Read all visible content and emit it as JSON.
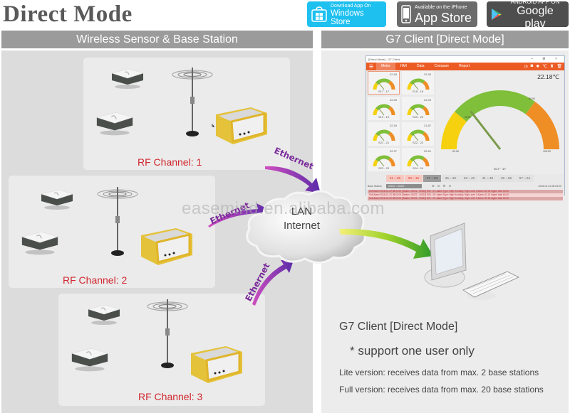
{
  "title": "Direct Mode",
  "store_badges": [
    {
      "small": "Download App On",
      "large": "Windows Store",
      "icon": "windows-icon",
      "color": "#1ec0f0"
    },
    {
      "small": "Available on the iPhone",
      "large": "App Store",
      "icon": "iphone-icon",
      "color": "#6b6b6b"
    },
    {
      "small": "ANDROID APP ON",
      "large": "Google play",
      "icon": "google-play-icon",
      "color": "#4e4e4e"
    }
  ],
  "sections": {
    "left_header": "Wireless Sensor & Base Station",
    "right_header": "G7 Client [Direct Mode]"
  },
  "rf_channels": [
    {
      "label": "RF Channel: 1"
    },
    {
      "label": "RF Channel: 2"
    },
    {
      "label": "RF Channel: 3"
    }
  ],
  "links": {
    "ethernet_label": "Ethernet",
    "cloud_line1": "LAN",
    "cloud_line2": "Internet",
    "watermark": "easemind.en.alibaba.com"
  },
  "app": {
    "window_title": "[Direct Mode] - G7 Client",
    "window_controls": "– ⚙ ×",
    "menu": [
      {
        "label": "Meter",
        "active": true
      },
      {
        "label": "HMI",
        "active": false
      },
      {
        "label": "Data",
        "active": false
      },
      {
        "label": "Compare",
        "active": false
      },
      {
        "label": "Report",
        "active": false
      }
    ],
    "menu_icons": [
      "clock-icon",
      "camera-icon",
      "sun-icon",
      "celsius-icon",
      "alarm-icon",
      "trash-icon"
    ],
    "menu_icon_glyphs": [
      "◷",
      "◙",
      "✹",
      "℃",
      "♜",
      "🗑"
    ],
    "mini_gauges": [
      {
        "value": "22.18",
        "label": "S17 - 17",
        "selected": true
      },
      {
        "value": "21.93",
        "label": "S18 - 18",
        "selected": false
      },
      {
        "value": "22.25",
        "label": "S19 - 19",
        "selected": false
      },
      {
        "value": "22.25",
        "label": "S20 - 20",
        "selected": false
      },
      {
        "value": "22.18",
        "label": "S21 - 21",
        "selected": false
      },
      {
        "value": "21.87",
        "label": "S22 - 22",
        "selected": false
      },
      {
        "value": "22.37",
        "label": "S23 - 23",
        "selected": false
      },
      {
        "value": "22.62",
        "label": "S24 - 24",
        "selected": false
      }
    ],
    "big_gauge": {
      "temperature": "22.18℃",
      "label": "S17 - 17",
      "min": "-20.00",
      "max": "125.00",
      "low": "15.00",
      "high": "80.00",
      "value_fraction": 0.29
    },
    "pages": [
      {
        "label": "01 ~ 08",
        "style": "red"
      },
      {
        "label": "09 ~ 16",
        "style": "red"
      },
      {
        "label": "17 ~ 24",
        "style": "dark"
      },
      {
        "label": "25 ~ 32",
        "style": "plain"
      },
      {
        "label": "33 ~ 40",
        "style": "plain"
      },
      {
        "label": "41 ~ 48",
        "style": "plain"
      },
      {
        "label": "49 ~ 56",
        "style": "plain"
      },
      {
        "label": "57 ~ 64",
        "style": "plain"
      }
    ],
    "base_station_label": "Base Station",
    "base_station_value": "00022 - 00022",
    "toolbar_icons": [
      "⊗",
      "⊘",
      "⚙",
      "⊖"
    ],
    "timestamp": "2018-01-22 08:03:00",
    "alarms": [
      "Soft Alarm 2018-01-22 08:03:00 [Station: 00022 - 00022] S01 - 01: Alarm Type: High Humidity, High Level 1 Alarm: 62.05 higher than 60.00",
      "Soft Alarm 2018-01-22 08:03:00 [Station: 00022 - 00022] S09 - 09: Alarm Type: High Humidity, High Level 1 Alarm: 62.14 higher than 60.00",
      "Soft Alarm 2018-01-22 08:03:00 [Station: 00022 - 00022] S01 - 01: Alarm Type: High Humidity, High Level 1 Alarm: 62.23 higher than 60.00"
    ]
  },
  "info": {
    "title": "G7 Client [Direct Mode]",
    "note": "* support one user only",
    "lite": "Lite version: receives data from max. 2 base stations",
    "full": "Full version: receives data from max. 20 base stations"
  }
}
